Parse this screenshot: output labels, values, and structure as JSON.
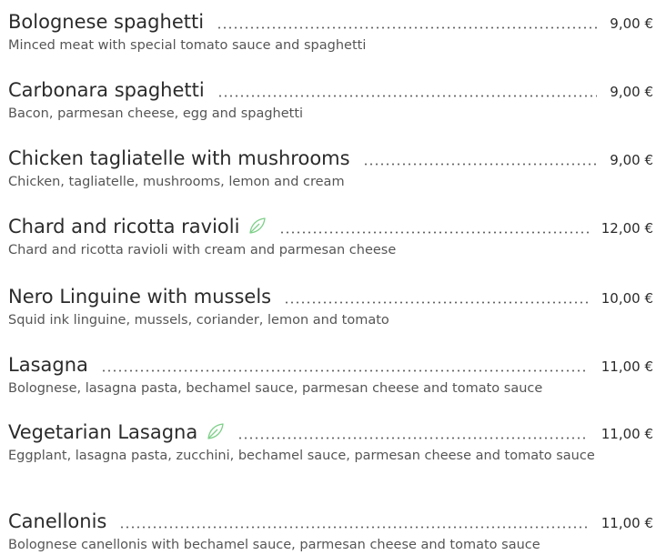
{
  "menu": {
    "items": [
      {
        "name": "Bolognese spaghetti",
        "price": "9,00 €",
        "desc": "Minced meat with special tomato sauce and spaghetti",
        "vegetarian": false
      },
      {
        "name": "Carbonara spaghetti",
        "price": "9,00 €",
        "desc": "Bacon, parmesan cheese, egg and spaghetti",
        "vegetarian": false
      },
      {
        "name": "Chicken tagliatelle with mushrooms",
        "price": "9,00 €",
        "desc": "Chicken, tagliatelle, mushrooms, lemon and cream",
        "vegetarian": false
      },
      {
        "name": "Chard and ricotta ravioli",
        "price": "12,00 €",
        "desc": "Chard and ricotta ravioli with cream and parmesan cheese",
        "vegetarian": true
      },
      {
        "name": "Nero Linguine with mussels",
        "price": "10,00 €",
        "desc": "Squid ink linguine, mussels, coriander, lemon and tomato",
        "vegetarian": false
      },
      {
        "name": "Lasagna",
        "price": "11,00 €",
        "desc": "Bolognese, lasagna pasta, bechamel sauce, parmesan cheese and tomato sauce",
        "vegetarian": false
      },
      {
        "name": "Vegetarian Lasagna",
        "price": "11,00 €",
        "desc": "Eggplant, lasagna pasta, zucchini, bechamel sauce, parmesan cheese and tomato sauce",
        "vegetarian": true
      },
      {
        "name": "Canellonis",
        "price": "11,00 €",
        "desc": "Bolognese canellonis with bechamel sauce, parmesan cheese and tomato sauce",
        "vegetarian": false
      }
    ],
    "leaf_icon": "leaf-icon",
    "leaf_color": "#7fd08a"
  }
}
